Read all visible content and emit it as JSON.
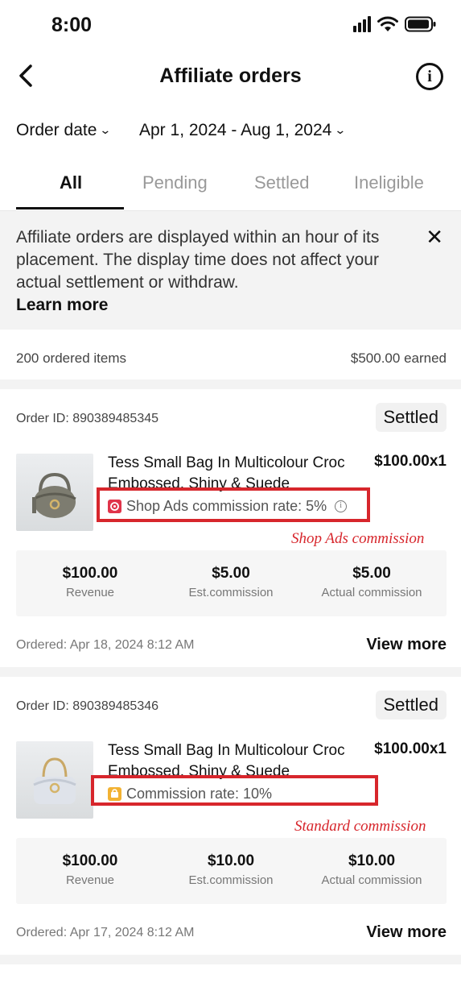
{
  "status_bar": {
    "time": "8:00"
  },
  "nav": {
    "title": "Affiliate orders",
    "back_icon": "chevron-left-icon",
    "info_icon": "info-icon"
  },
  "filters": {
    "order_date_label": "Order date",
    "date_range": "Apr 1, 2024 - Aug 1, 2024"
  },
  "tabs": [
    {
      "label": "All",
      "active": true
    },
    {
      "label": "Pending",
      "active": false
    },
    {
      "label": "Settled",
      "active": false
    },
    {
      "label": "Ineligible",
      "active": false
    }
  ],
  "notice": {
    "text": "Affiliate orders are displayed within an hour of its placement. The display time does not affect your actual settlement or withdraw.",
    "link": "Learn more"
  },
  "summary": {
    "items": "200 ordered items",
    "earned": "$500.00 earned"
  },
  "orders": [
    {
      "order_id": "Order ID: 890389485345",
      "status": "Settled",
      "product_title": "Tess Small Bag In Multicolour Croc Embossed, Shiny & Suede",
      "price": "$100.00x1",
      "rate_text": "Shop Ads commission rate: 5%",
      "rate_icon_color": "#e0344a",
      "annotation": "Shop Ads commission",
      "stats": [
        {
          "value": "$100.00",
          "label": "Revenue"
        },
        {
          "value": "$5.00",
          "label": "Est.commission"
        },
        {
          "value": "$5.00",
          "label": "Actual commission"
        }
      ],
      "ordered": "Ordered: Apr 18, 2024 8:12 AM",
      "view_more": "View more"
    },
    {
      "order_id": "Order ID: 890389485346",
      "status": "Settled",
      "product_title": "Tess Small Bag In Multicolour Croc Embossed, Shiny & Suede",
      "price": "$100.00x1",
      "rate_text": "Commission rate: 10%",
      "rate_icon_color": "#f2b233",
      "annotation": "Standard commission",
      "stats": [
        {
          "value": "$100.00",
          "label": "Revenue"
        },
        {
          "value": "$10.00",
          "label": "Est.commission"
        },
        {
          "value": "$10.00",
          "label": "Actual commission"
        }
      ],
      "ordered": "Ordered: Apr 17, 2024 8:12 AM",
      "view_more": "View more"
    }
  ],
  "colors": {
    "highlight": "#d7262c"
  }
}
